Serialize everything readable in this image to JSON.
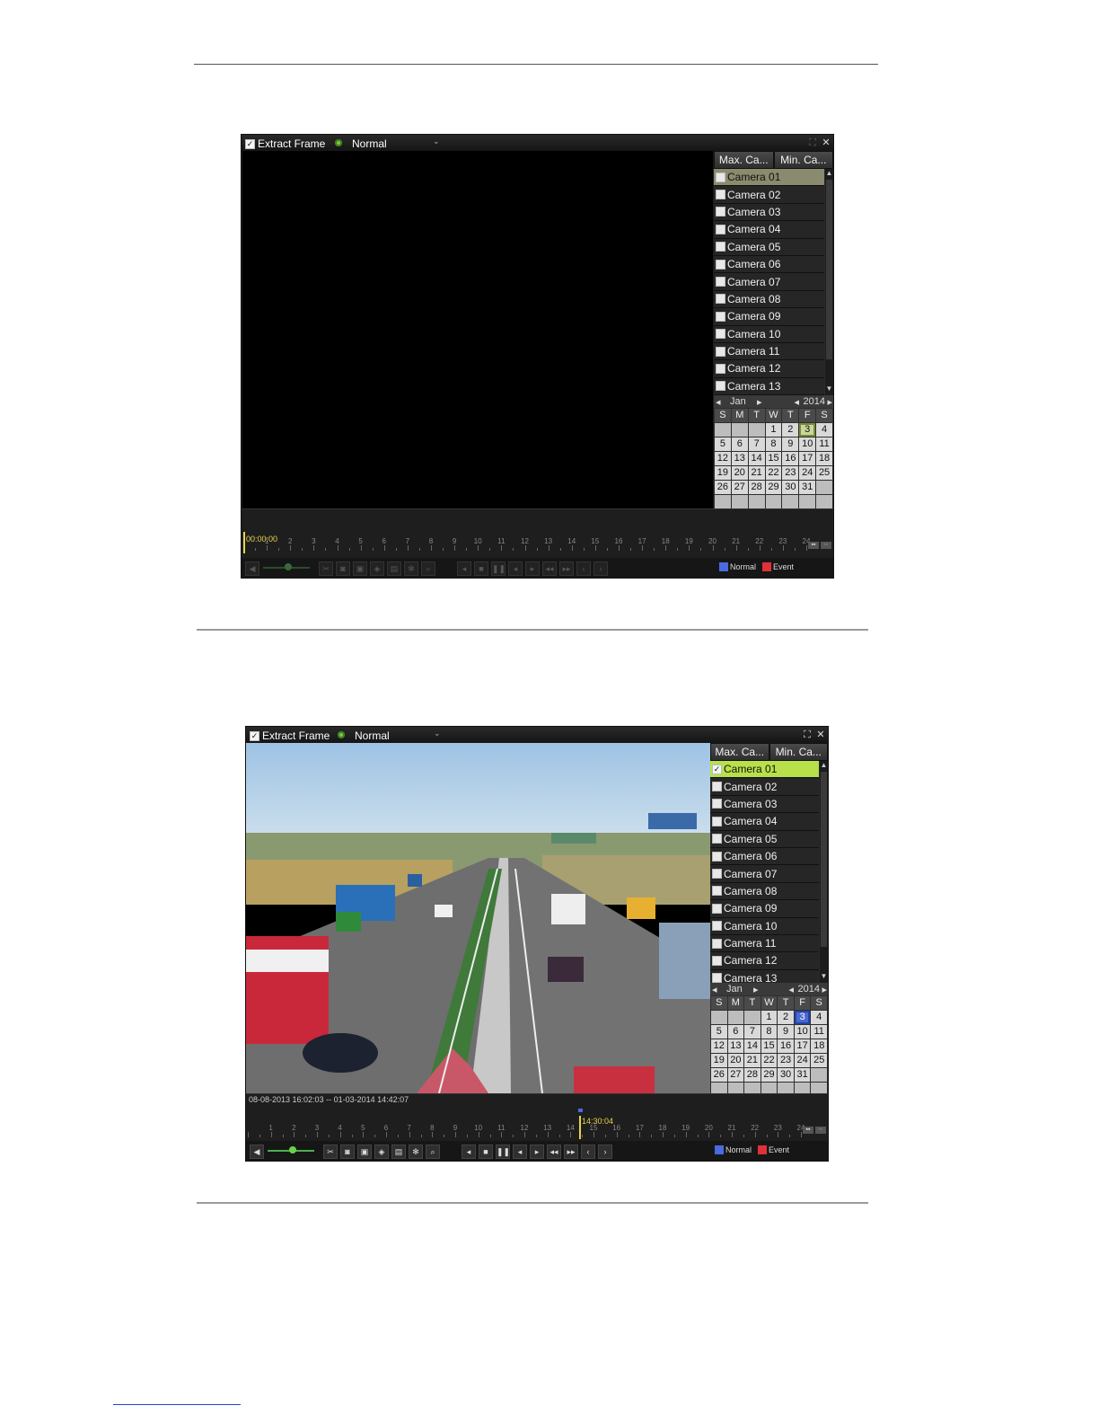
{
  "toolbar": {
    "extract_frame_label": "Extract Frame",
    "mode_value": "Normal"
  },
  "sidebar": {
    "max_cam_label": "Max. Ca...",
    "min_cam_label": "Min. Ca...",
    "cameras": [
      "Camera 01",
      "Camera 02",
      "Camera 03",
      "Camera 04",
      "Camera 05",
      "Camera 06",
      "Camera 07",
      "Camera 08",
      "Camera 09",
      "Camera 10",
      "Camera 11",
      "Camera 12",
      "Camera 13"
    ]
  },
  "calendar": {
    "month": "Jan",
    "year": "2014",
    "weekdays": [
      "S",
      "M",
      "T",
      "W",
      "T",
      "F",
      "S"
    ],
    "days": [
      "",
      "",
      "",
      "1",
      "2",
      "3",
      "4",
      "5",
      "6",
      "7",
      "8",
      "9",
      "10",
      "11",
      "12",
      "13",
      "14",
      "15",
      "16",
      "17",
      "18",
      "19",
      "20",
      "21",
      "22",
      "23",
      "24",
      "25",
      "26",
      "27",
      "28",
      "29",
      "30",
      "31",
      "",
      "",
      "",
      "",
      "",
      "",
      "",
      "",
      ""
    ],
    "selected_day": "3"
  },
  "timeline": {
    "hours": [
      "1",
      "2",
      "3",
      "4",
      "5",
      "6",
      "7",
      "8",
      "9",
      "10",
      "11",
      "12",
      "13",
      "14",
      "15",
      "16",
      "17",
      "18",
      "19",
      "20",
      "21",
      "22",
      "23",
      "24"
    ],
    "screen1_time": "00:00:00",
    "screen2_time": "14:30:04",
    "screen2_range": "08-08-2013 16:02:03 -- 01-03-2014 14:42:07"
  },
  "legend": {
    "normal_label": "Normal",
    "event_label": "Event",
    "normal_color": "#4a6ae0",
    "event_color": "#e0303a"
  },
  "icons": [
    "close-icon",
    "fullscreen-icon",
    "speaker-icon",
    "scissors-icon",
    "camera-icon",
    "lock-icon",
    "tag-icon",
    "folder-icon",
    "gear-icon",
    "zoom-icon",
    "prev-icon",
    "stop-icon",
    "pause-icon",
    "step-back-icon",
    "step-forward-icon",
    "rewind-icon",
    "fast-forward-icon",
    "prev-day-icon",
    "next-day-icon"
  ]
}
